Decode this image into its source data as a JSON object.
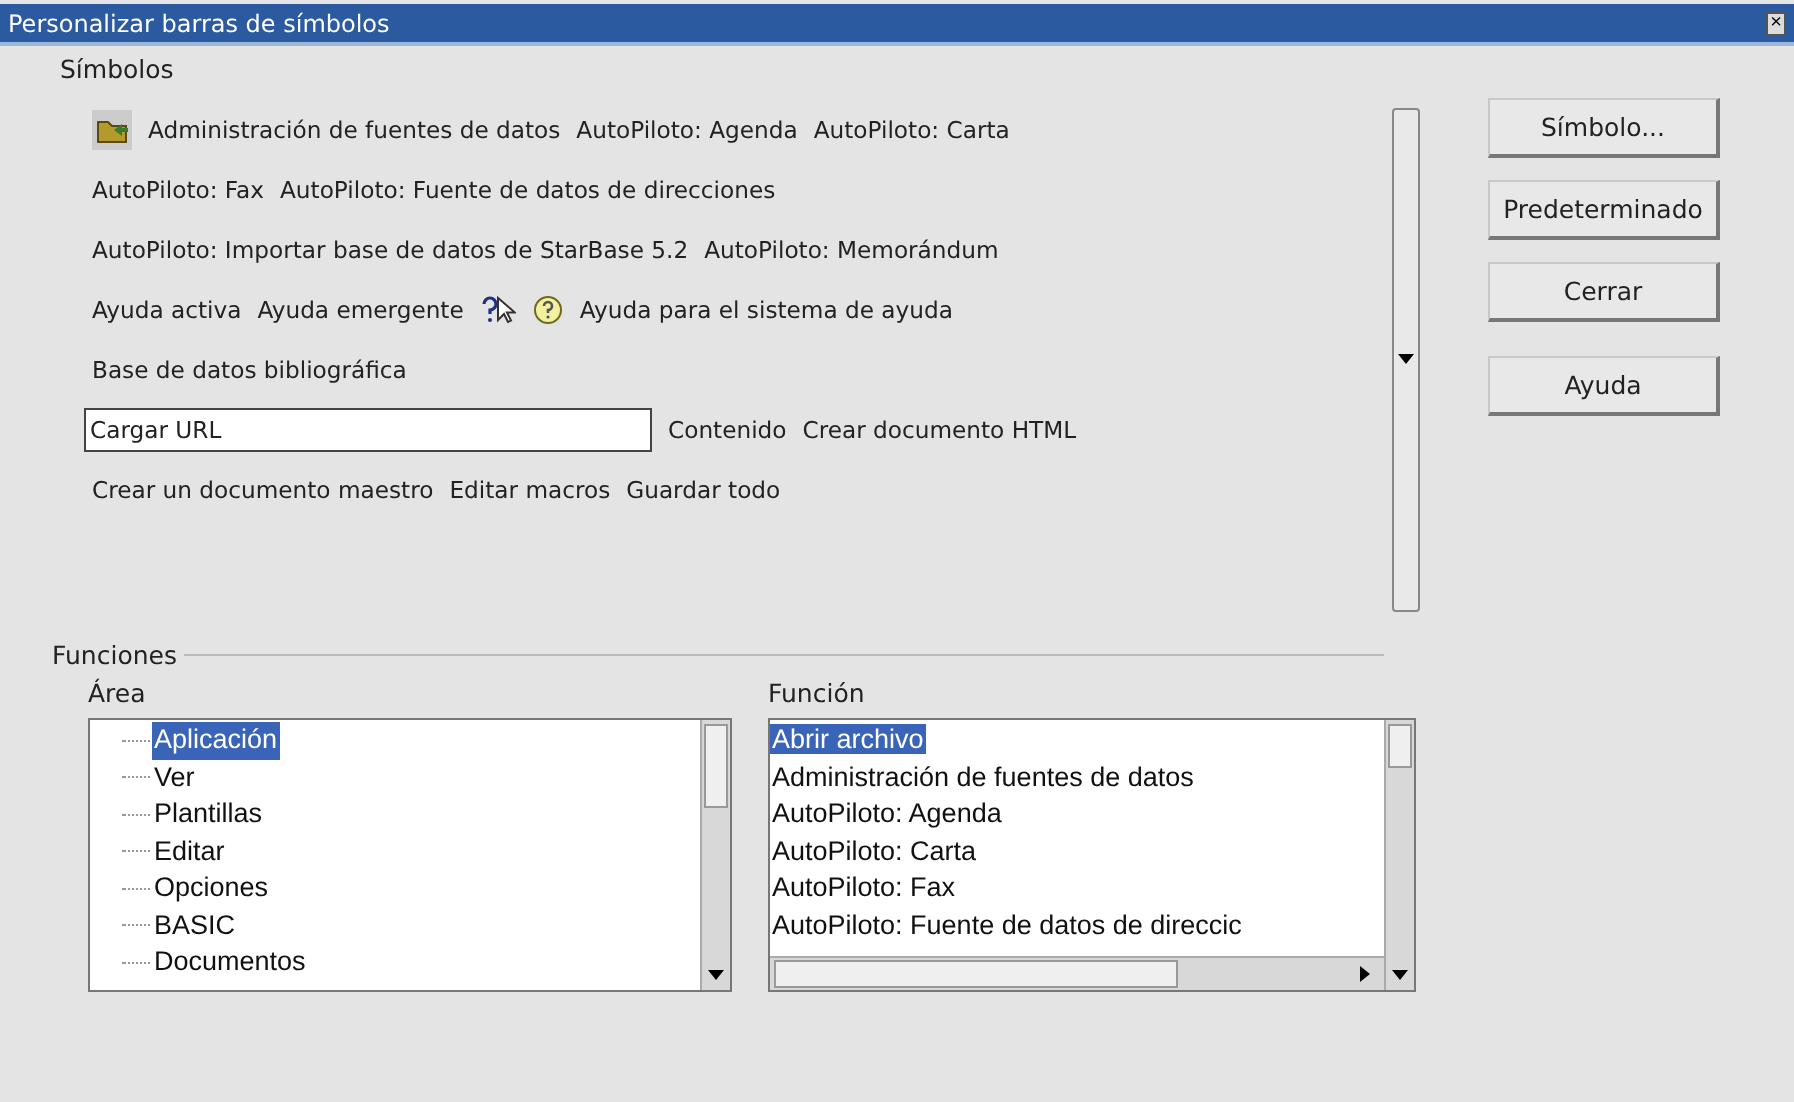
{
  "window": {
    "title": "Personalizar barras de símbolos",
    "close": "×"
  },
  "symbols": {
    "label": "Símbolos",
    "rows": [
      {
        "items": [
          {
            "kind": "folder"
          },
          {
            "kind": "text",
            "text": "Administración de fuentes de datos"
          },
          {
            "kind": "text",
            "text": "AutoPiloto: Agenda"
          },
          {
            "kind": "text",
            "text": "AutoPiloto: Carta"
          }
        ]
      },
      {
        "items": [
          {
            "kind": "text",
            "text": "AutoPiloto: Fax"
          },
          {
            "kind": "text",
            "text": "AutoPiloto: Fuente de datos de direcciones"
          }
        ]
      },
      {
        "items": [
          {
            "kind": "text",
            "text": "AutoPiloto: Importar base de datos de StarBase 5.2"
          },
          {
            "kind": "text",
            "text": "AutoPiloto: Memorándum"
          }
        ]
      },
      {
        "items": [
          {
            "kind": "text",
            "text": "Ayuda activa"
          },
          {
            "kind": "text",
            "text": "Ayuda emergente"
          },
          {
            "kind": "pointer"
          },
          {
            "kind": "help"
          },
          {
            "kind": "text",
            "text": "Ayuda para el sistema de ayuda"
          }
        ]
      },
      {
        "items": [
          {
            "kind": "text",
            "text": "Base de datos bibliográfica"
          }
        ]
      },
      {
        "items": [
          {
            "kind": "field",
            "text": "Cargar URL"
          },
          {
            "kind": "text",
            "text": "Contenido"
          },
          {
            "kind": "text",
            "text": "Crear documento HTML"
          }
        ]
      },
      {
        "items": [
          {
            "kind": "text",
            "text": "Crear un documento maestro"
          },
          {
            "kind": "text",
            "text": "Editar macros"
          },
          {
            "kind": "text",
            "text": "Guardar todo"
          }
        ]
      }
    ]
  },
  "buttons": [
    "Símbolo...",
    "Predeterminado",
    "Cerrar",
    "Ayuda"
  ],
  "functions": {
    "label": "Funciones",
    "area": {
      "label": "Área",
      "items": [
        {
          "text": "Aplicación",
          "selected": true
        },
        {
          "text": "Ver",
          "selected": false
        },
        {
          "text": "Plantillas",
          "selected": false
        },
        {
          "text": "Editar",
          "selected": false
        },
        {
          "text": "Opciones",
          "selected": false
        },
        {
          "text": "BASIC",
          "selected": false
        },
        {
          "text": "Documentos",
          "selected": false
        }
      ]
    },
    "function": {
      "label": "Función",
      "items": [
        {
          "text": "Abrir archivo",
          "selected": true
        },
        {
          "text": "Administración de fuentes de datos",
          "selected": false
        },
        {
          "text": "AutoPiloto: Agenda",
          "selected": false
        },
        {
          "text": "AutoPiloto: Carta",
          "selected": false
        },
        {
          "text": "AutoPiloto: Fax",
          "selected": false
        },
        {
          "text": "AutoPiloto: Fuente de datos de direccic",
          "selected": false
        }
      ]
    }
  }
}
